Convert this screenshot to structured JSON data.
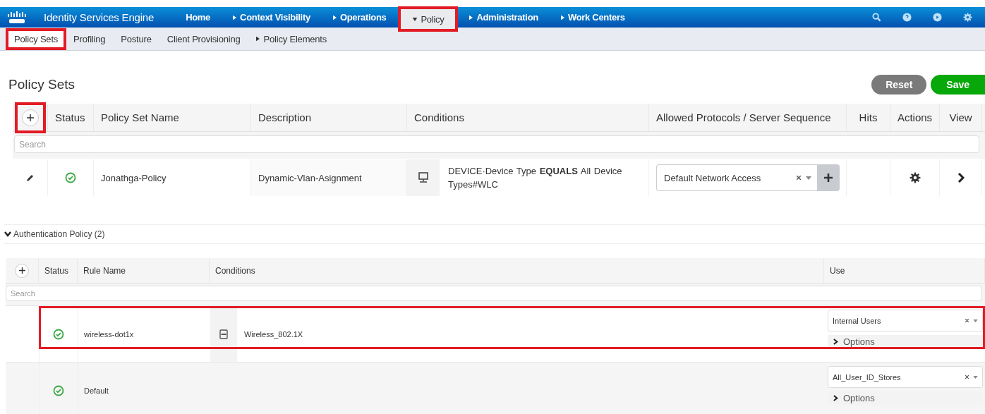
{
  "header": {
    "product": "Identity Services Engine"
  },
  "nav": [
    {
      "label": "Home",
      "kind": "plain",
      "highlighted": false
    },
    {
      "label": "Context Visibility",
      "kind": "submenu",
      "highlighted": false
    },
    {
      "label": "Operations",
      "kind": "submenu",
      "highlighted": false
    },
    {
      "label": "Policy",
      "kind": "dropdown",
      "highlighted": true
    },
    {
      "label": "Administration",
      "kind": "submenu",
      "highlighted": false
    },
    {
      "label": "Work Centers",
      "kind": "submenu",
      "highlighted": false
    }
  ],
  "subnav": [
    {
      "label": "Policy Sets",
      "kind": "plain",
      "selected": true,
      "highlighted": true
    },
    {
      "label": "Profiling",
      "kind": "plain",
      "selected": false,
      "highlighted": false
    },
    {
      "label": "Posture",
      "kind": "plain",
      "selected": false,
      "highlighted": false
    },
    {
      "label": "Client Provisioning",
      "kind": "plain",
      "selected": false,
      "highlighted": false
    },
    {
      "label": "Policy Elements",
      "kind": "submenu",
      "selected": false,
      "highlighted": false
    }
  ],
  "page_title": "Policy Sets",
  "buttons": [
    {
      "label": "Reset",
      "kind": "secondary"
    },
    {
      "label": "Save",
      "kind": "primary"
    }
  ],
  "policy_table": {
    "add_highlighted": true,
    "columns": [
      "Status",
      "Policy Set Name",
      "Description",
      "Conditions",
      "Allowed Protocols / Server Sequence",
      "Hits",
      "Actions",
      "View"
    ],
    "search": {
      "placeholder": "Search"
    },
    "rows": [
      {
        "enabled": true,
        "name": "Jonathga-Policy",
        "description": "Dynamic-Vlan-Asignment",
        "conditions": "DEVICE·Device Type  **EQUALS**  All Device Types#WLC",
        "protocol": "Default Network Access"
      }
    ]
  },
  "auth_policy": {
    "title": "Authentication Policy (2)",
    "expanded": true,
    "columns": [
      "Status",
      "Rule Name",
      "Conditions",
      "Use"
    ],
    "search": {
      "placeholder": "Search"
    },
    "rows": [
      {
        "enabled": true,
        "name": "wireless-dot1x",
        "condition": "Wireless_802.1X",
        "use": "Internal Users",
        "options": "Options",
        "highlighted": true
      },
      {
        "enabled": true,
        "name": "Default",
        "use": "All_User_ID_Stores",
        "options": "Options",
        "highlighted": false
      }
    ]
  }
}
